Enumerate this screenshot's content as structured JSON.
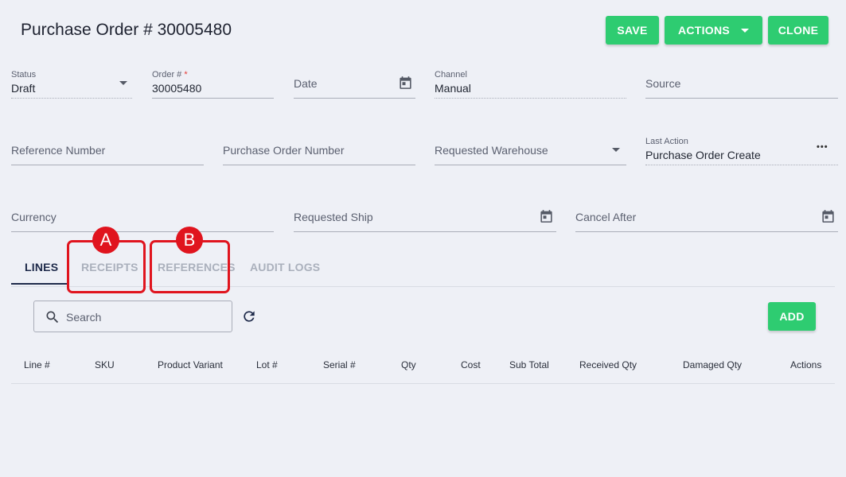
{
  "header": {
    "title": "Purchase Order # 30005480",
    "save_label": "SAVE",
    "actions_label": "ACTIONS",
    "clone_label": "CLONE"
  },
  "form": {
    "status": {
      "label": "Status",
      "value": "Draft"
    },
    "order_number": {
      "label": "Order #",
      "required_mark": "*",
      "value": "30005480"
    },
    "date": {
      "placeholder": "Date"
    },
    "channel": {
      "label": "Channel",
      "value": "Manual"
    },
    "source": {
      "placeholder": "Source"
    },
    "reference_number": {
      "placeholder": "Reference Number"
    },
    "purchase_order_number": {
      "placeholder": "Purchase Order Number"
    },
    "requested_warehouse": {
      "placeholder": "Requested Warehouse"
    },
    "last_action": {
      "label": "Last Action",
      "value": "Purchase Order Create",
      "more": "•••"
    },
    "currency": {
      "placeholder": "Currency"
    },
    "requested_ship": {
      "placeholder": "Requested Ship"
    },
    "cancel_after": {
      "placeholder": "Cancel After"
    }
  },
  "tabs": [
    {
      "label": "LINES",
      "active": true
    },
    {
      "label": "RECEIPTS",
      "active": false
    },
    {
      "label": "REFERENCES",
      "active": false
    },
    {
      "label": "AUDIT LOGS",
      "active": false
    }
  ],
  "callouts": {
    "a": "A",
    "b": "B"
  },
  "toolbar": {
    "search_placeholder": "Search",
    "add_label": "ADD"
  },
  "table": {
    "columns": [
      "Line #",
      "SKU",
      "Product Variant",
      "Lot #",
      "Serial #",
      "Qty",
      "Cost",
      "Sub Total",
      "Received Qty",
      "Damaged Qty",
      "Actions"
    ]
  },
  "colors": {
    "primary_button": "#2ecc71",
    "callout_red": "#e0141e",
    "background": "#eef0f6",
    "active_tab": "#1e2a4a"
  }
}
